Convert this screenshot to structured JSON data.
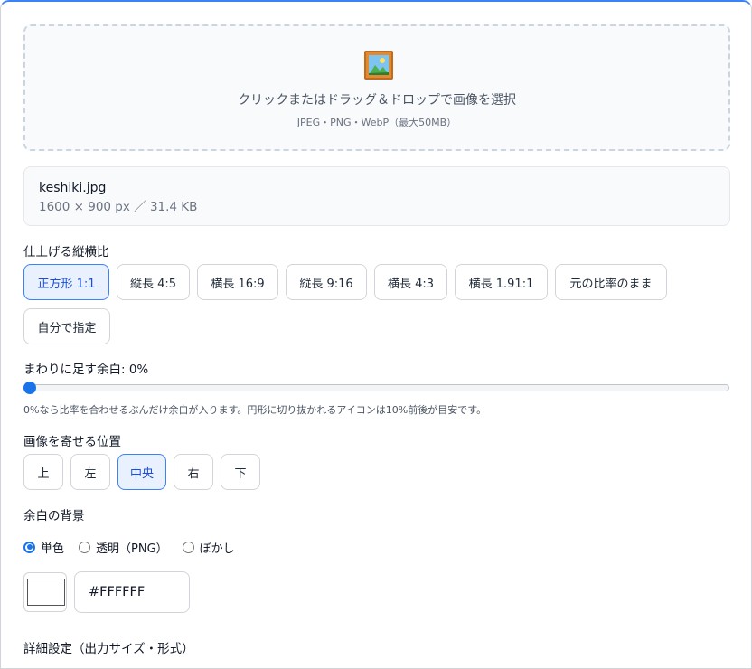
{
  "upload": {
    "icon": "framed-picture-icon",
    "text": "クリックまたはドラッグ＆ドロップで画像を選択",
    "formats": "JPEG・PNG・WebP（最大50MB）"
  },
  "file": {
    "name": "keshiki.jpg",
    "meta": "1600 × 900 px ／ 31.4 KB"
  },
  "aspect": {
    "label": "仕上げる縦横比",
    "options": [
      "正方形 1:1",
      "縦長 4:5",
      "横長 16:9",
      "縦長 9:16",
      "横長 4:3",
      "横長 1.91:1",
      "元の比率のまま",
      "自分で指定"
    ],
    "selected": "正方形 1:1"
  },
  "padding": {
    "label": "まわりに足す余白: 0%",
    "value_percent": 0,
    "hint": "0%なら比率を合わせるぶんだけ余白が入ります。円形に切り抜かれるアイコンは10%前後が目安です。"
  },
  "position": {
    "label": "画像を寄せる位置",
    "options": [
      "上",
      "左",
      "中央",
      "右",
      "下"
    ],
    "selected": "中央"
  },
  "background": {
    "label": "余白の背景",
    "options": [
      "単色",
      "透明（PNG）",
      "ぼかし"
    ],
    "selected": "単色",
    "color_hex": "#FFFFFF"
  },
  "details": {
    "label": "詳細設定（出力サイズ・形式）"
  },
  "colors": {
    "accent": "#1a73e8",
    "active_bg": "#e8f1fd"
  }
}
